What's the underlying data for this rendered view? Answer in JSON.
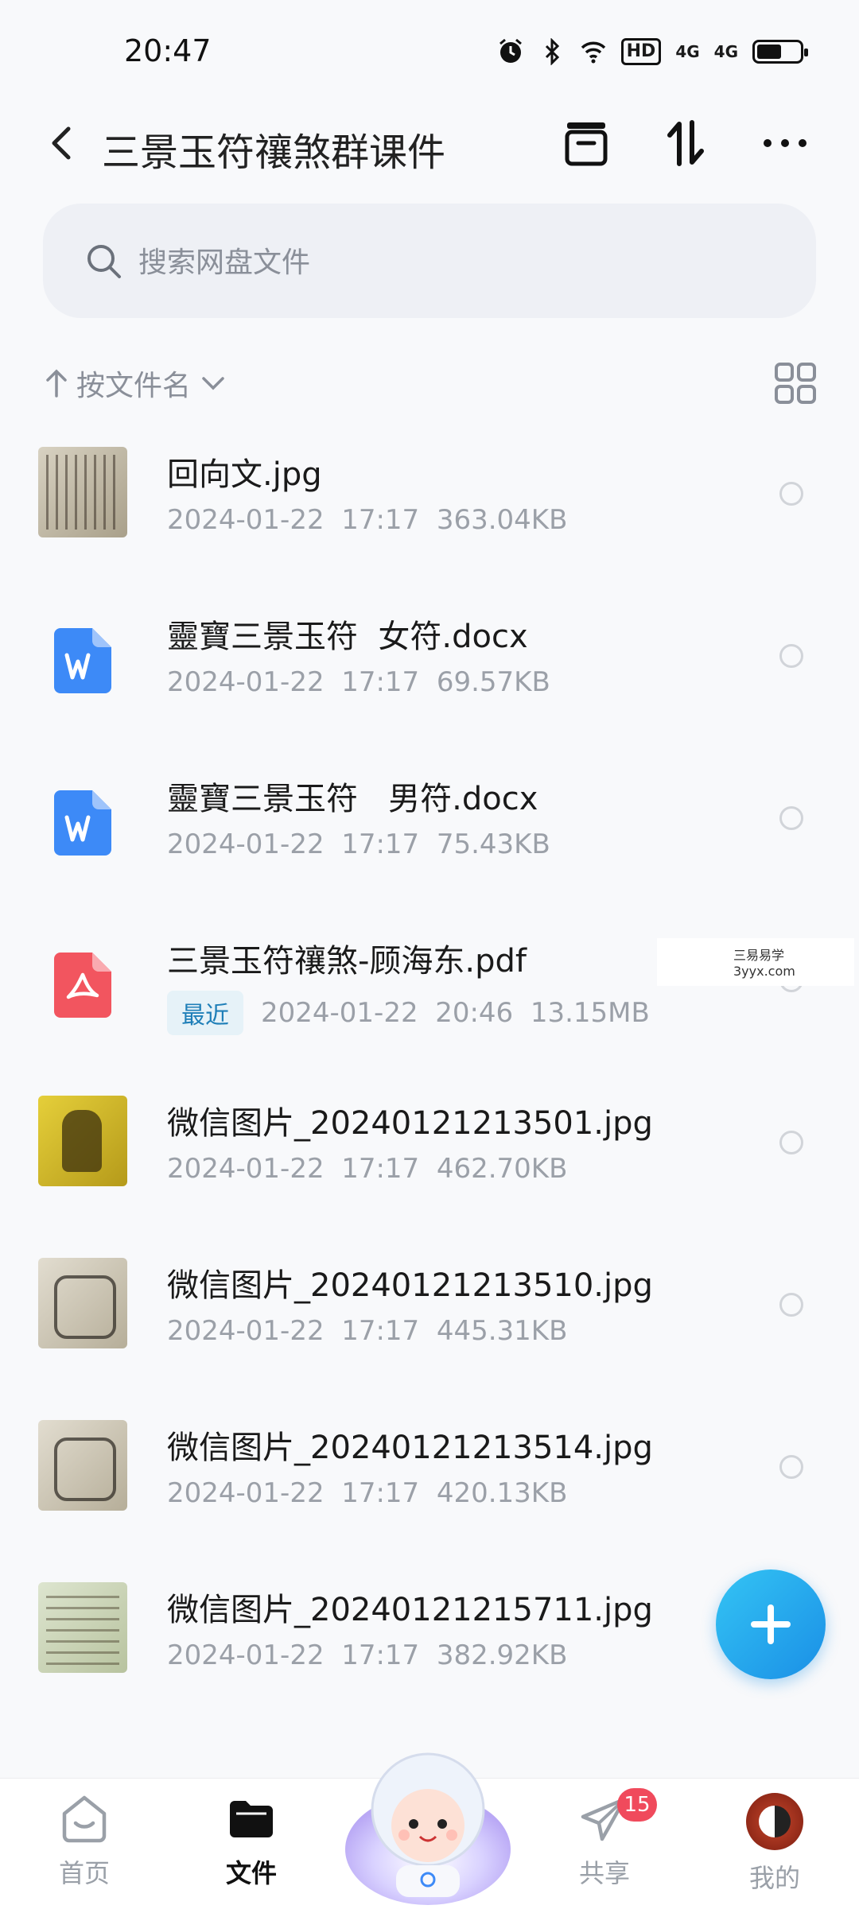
{
  "status_bar": {
    "time": "20:47",
    "icons": [
      "alarm-icon",
      "bluetooth-icon",
      "wifi-icon",
      "hd-icon",
      "signal-4g-icon",
      "signal-4g-icon",
      "battery-icon"
    ],
    "hd_label": "HD",
    "sig1": "4G",
    "sig2": "4G"
  },
  "header": {
    "title": "三景玉符禳煞群课件"
  },
  "search": {
    "placeholder": "搜索网盘文件"
  },
  "sort": {
    "label": "按文件名"
  },
  "files": [
    {
      "name": "回向文.jpg",
      "date": "2024-01-22  17:17",
      "size": "363.04KB",
      "kind": "image",
      "thumb": "photo",
      "badge": ""
    },
    {
      "name": "靈寶三景玉符  女符.docx",
      "date": "2024-01-22  17:17",
      "size": "69.57KB",
      "kind": "word",
      "thumb": "",
      "badge": ""
    },
    {
      "name": "靈寶三景玉符   男符.docx",
      "date": "2024-01-22  17:17",
      "size": "75.43KB",
      "kind": "word",
      "thumb": "",
      "badge": ""
    },
    {
      "name": "三景玉符禳煞-顾海东.pdf",
      "date": "2024-01-22  20:46",
      "size": "13.15MB",
      "kind": "pdf",
      "thumb": "",
      "badge": "最近"
    },
    {
      "name": "微信图片_20240121213501.jpg",
      "date": "2024-01-22  17:17",
      "size": "462.70KB",
      "kind": "image",
      "thumb": "yellow",
      "badge": ""
    },
    {
      "name": "微信图片_20240121213510.jpg",
      "date": "2024-01-22  17:17",
      "size": "445.31KB",
      "kind": "image",
      "thumb": "print",
      "badge": ""
    },
    {
      "name": "微信图片_20240121213514.jpg",
      "date": "2024-01-22  17:17",
      "size": "420.13KB",
      "kind": "image",
      "thumb": "print",
      "badge": ""
    },
    {
      "name": "微信图片_20240121215711.jpg",
      "date": "2024-01-22  17:17",
      "size": "382.92KB",
      "kind": "image",
      "thumb": "green",
      "badge": ""
    }
  ],
  "watermark": {
    "line1": "三易易学",
    "line2": "3yyx.com"
  },
  "bottom_nav": {
    "home": "首页",
    "files": "文件",
    "share": "共享",
    "share_badge": "15",
    "mine": "我的"
  },
  "colors": {
    "accent": "#1a8fe6",
    "word": "#3d8af7",
    "pdf": "#f2555f",
    "badge_red": "#f04a5c"
  }
}
